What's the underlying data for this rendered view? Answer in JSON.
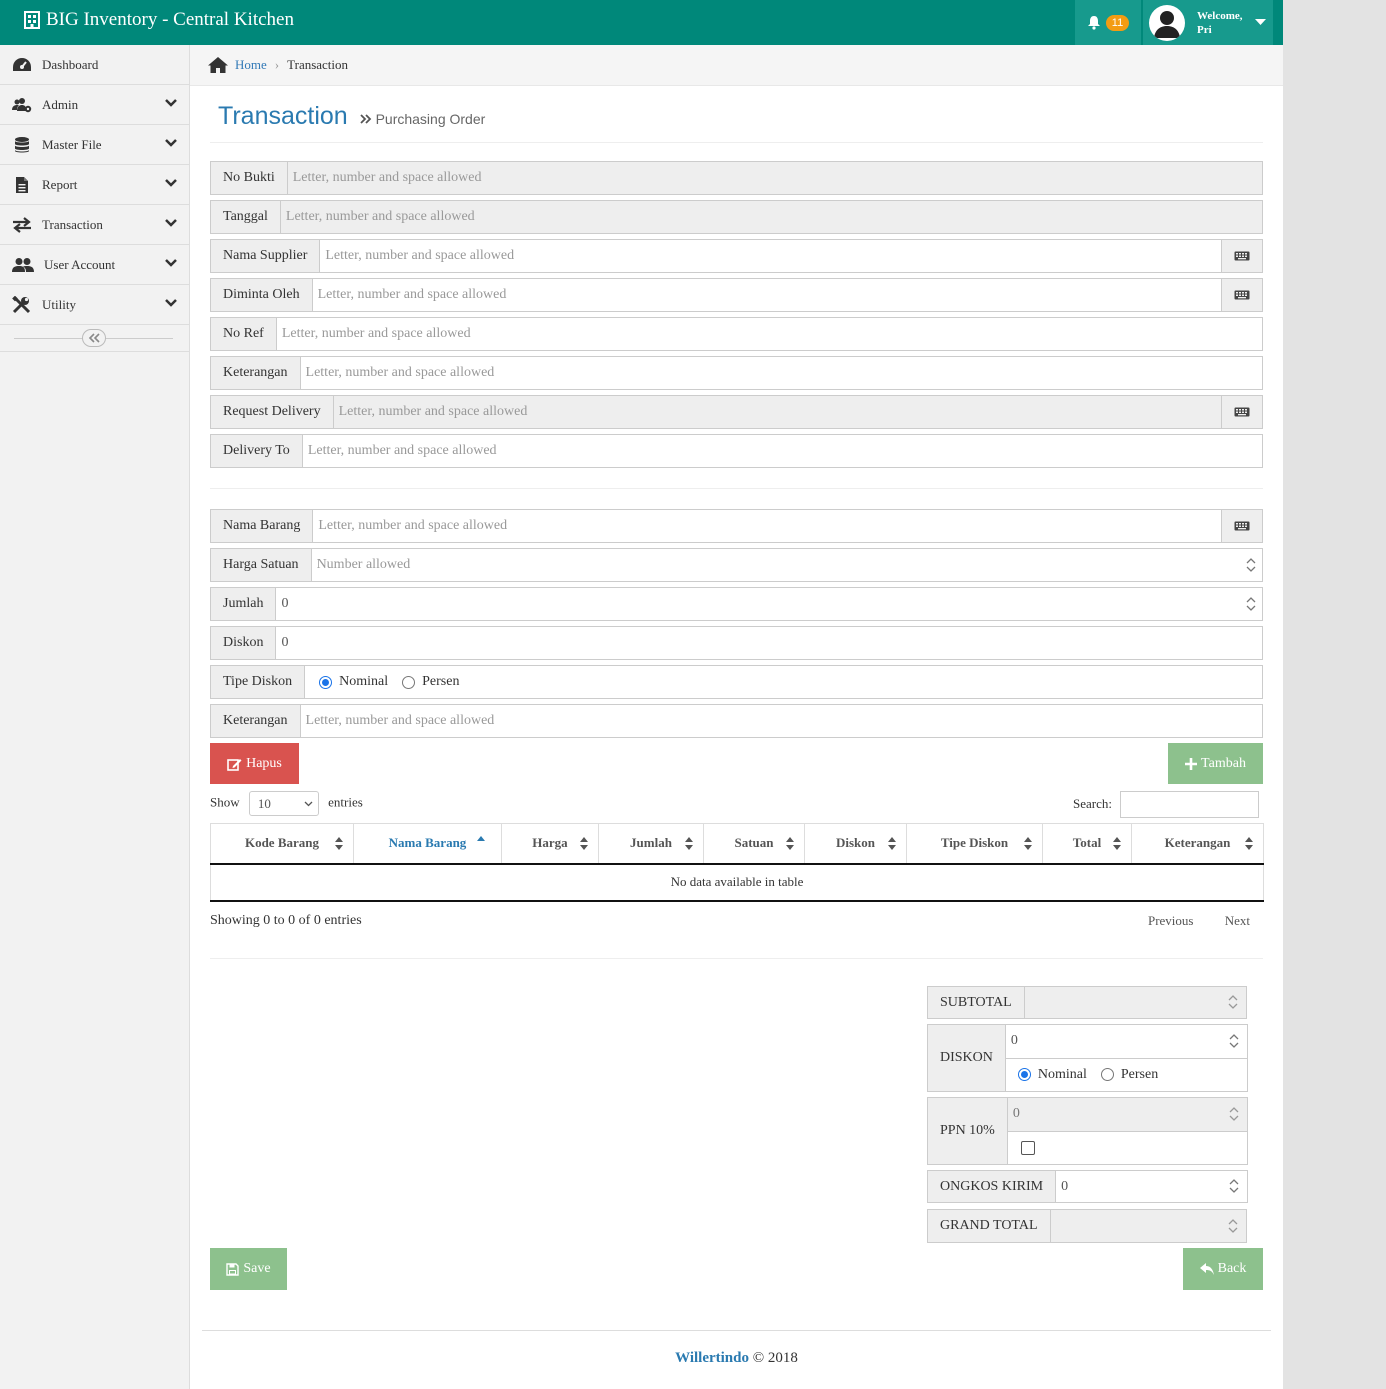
{
  "app": {
    "title": "BIG Inventory - Central Kitchen",
    "notification_count": "11",
    "welcome_label": "Welcome,",
    "user_name": "Pri"
  },
  "sidebar": {
    "items": [
      {
        "label": "Dashboard",
        "icon": "dashboard-icon"
      },
      {
        "label": "Admin",
        "icon": "users-cog-icon"
      },
      {
        "label": "Master File",
        "icon": "database-icon"
      },
      {
        "label": "Report",
        "icon": "file-icon"
      },
      {
        "label": "Transaction",
        "icon": "exchange-icon"
      },
      {
        "label": "User Account",
        "icon": "user-group-icon"
      },
      {
        "label": "Utility",
        "icon": "tools-icon"
      }
    ]
  },
  "breadcrumb": {
    "home": "Home",
    "current": "Transaction"
  },
  "page": {
    "title": "Transaction",
    "subtitle": "Purchasing Order"
  },
  "header_form": {
    "no_bukti": {
      "label": "No Bukti",
      "placeholder": "Letter, number and space allowed"
    },
    "tanggal": {
      "label": "Tanggal",
      "placeholder": "Letter, number and space allowed"
    },
    "nama_supplier": {
      "label": "Nama Supplier",
      "placeholder": "Letter, number and space allowed"
    },
    "diminta_oleh": {
      "label": "Diminta Oleh",
      "placeholder": "Letter, number and space allowed"
    },
    "no_ref": {
      "label": "No Ref",
      "placeholder": "Letter, number and space allowed"
    },
    "keterangan": {
      "label": "Keterangan",
      "placeholder": "Letter, number and space allowed"
    },
    "request_delivery": {
      "label": "Request Delivery",
      "placeholder": "Letter, number and space allowed"
    },
    "delivery_to": {
      "label": "Delivery To",
      "placeholder": "Letter, number and space allowed"
    }
  },
  "item_form": {
    "nama_barang": {
      "label": "Nama Barang",
      "placeholder": "Letter, number and space allowed"
    },
    "harga_satuan": {
      "label": "Harga Satuan",
      "placeholder": "Number allowed"
    },
    "jumlah": {
      "label": "Jumlah",
      "value": "0"
    },
    "diskon": {
      "label": "Diskon",
      "value": "0"
    },
    "tipe_diskon": {
      "label": "Tipe Diskon",
      "option_nominal": "Nominal",
      "option_persen": "Persen",
      "selected": "Nominal"
    },
    "keterangan": {
      "label": "Keterangan",
      "placeholder": "Letter, number and space allowed"
    }
  },
  "buttons": {
    "hapus": "Hapus",
    "tambah": "Tambah",
    "save": "Save",
    "back": "Back"
  },
  "table": {
    "show_label": "Show",
    "entries_label": "entries",
    "page_length": "10",
    "search_label": "Search:",
    "columns": [
      "Kode Barang",
      "Nama Barang",
      "Harga",
      "Jumlah",
      "Satuan",
      "Diskon",
      "Tipe Diskon",
      "Total",
      "Keterangan"
    ],
    "sorted_column": "Nama Barang",
    "empty_text": "No data available in table",
    "info": "Showing 0 to 0 of 0 entries",
    "previous": "Previous",
    "next": "Next"
  },
  "totals": {
    "subtotal": {
      "label": "SUBTOTAL",
      "value": ""
    },
    "diskon": {
      "label": "DISKON",
      "value": "0",
      "option_nominal": "Nominal",
      "option_persen": "Persen",
      "selected": "Nominal"
    },
    "ppn": {
      "label": "PPN 10%",
      "value": "0",
      "checked": false
    },
    "ongkos_kirim": {
      "label": "ONGKOS KIRIM",
      "value": "0"
    },
    "grand_total": {
      "label": "GRAND TOTAL",
      "value": ""
    }
  },
  "footer": {
    "brand": "Willertindo",
    "copyright": "© 2018"
  },
  "colors": {
    "topbar": "#00887a",
    "accent": "#2a7ab0",
    "danger": "#d9534f",
    "success": "#8dc18d",
    "badge": "#f39c12"
  }
}
